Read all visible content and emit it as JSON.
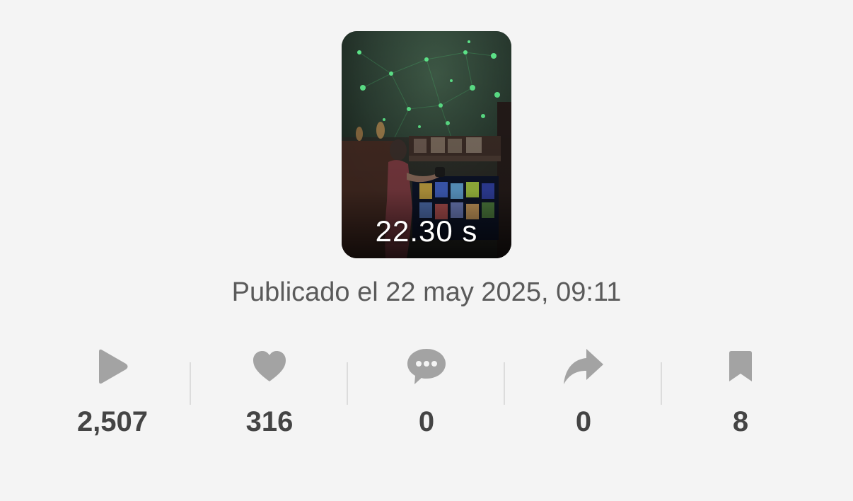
{
  "video": {
    "duration": "22.30 s",
    "published": "Publicado el 22 may 2025, 09:11"
  },
  "stats": [
    {
      "icon": "play-icon",
      "value": "2,507"
    },
    {
      "icon": "heart-icon",
      "value": "316"
    },
    {
      "icon": "comment-icon",
      "value": "0"
    },
    {
      "icon": "share-icon",
      "value": "0"
    },
    {
      "icon": "bookmark-icon",
      "value": "8"
    }
  ],
  "colors": {
    "background": "#f4f4f4",
    "icon": "#a3a3a3",
    "text": "#444444"
  }
}
